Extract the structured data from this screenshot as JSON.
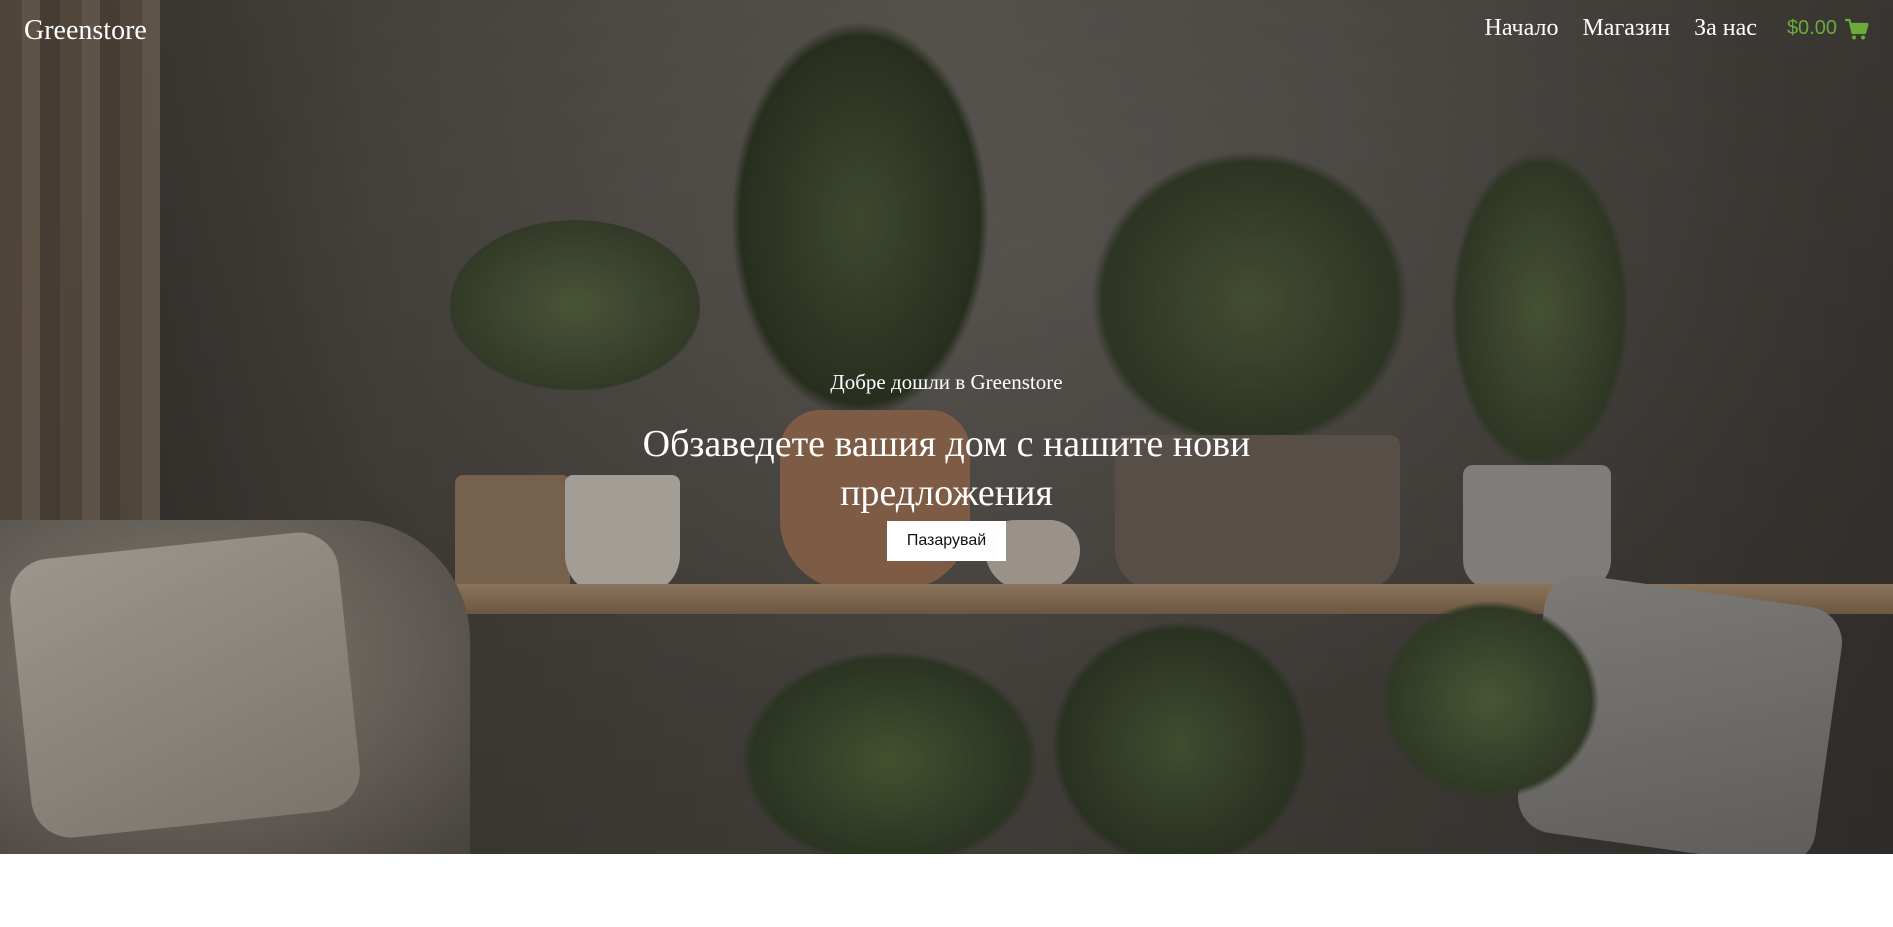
{
  "brand": {
    "name": "Greenstore"
  },
  "nav": {
    "items": [
      {
        "label": "Начало"
      },
      {
        "label": "Магазин"
      },
      {
        "label": "За нас"
      }
    ],
    "cart_total": "$0.00",
    "cart_icon": "shopping-cart-icon"
  },
  "hero": {
    "subtitle": "Добре дошли в Greenstore",
    "title": "Обзаведете вашия дом с нашите нови предложения",
    "cta_label": "Пазарувай"
  },
  "colors": {
    "accent": "#6aab3a",
    "text_on_hero": "#ffffff",
    "button_bg": "#ffffff"
  }
}
